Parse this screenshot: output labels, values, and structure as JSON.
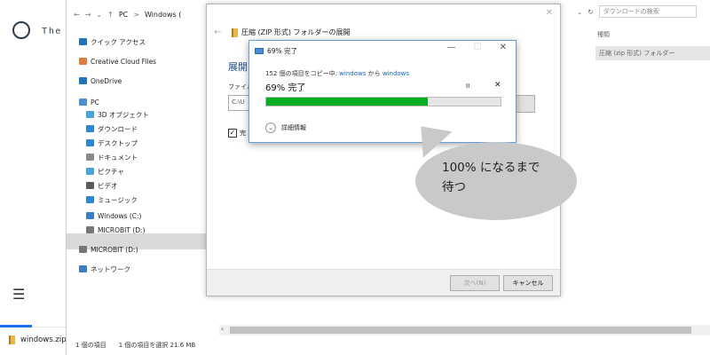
{
  "webpage": {
    "logo_text": "The",
    "menu_icon": "hamburger-icon"
  },
  "download_bar": {
    "filename": "windows.zip"
  },
  "explorer": {
    "address": {
      "root": "PC",
      "sep": ">",
      "current": "Windows ("
    },
    "search_placeholder": "ダウンロードの検索",
    "refresh_icon": "refresh-icon",
    "column_type": "種類",
    "row_type_value": "圧縮 (zip 形式) フォルダー",
    "nav": [
      {
        "label": "クイック アクセス",
        "icon": "star-icon",
        "color": "#1e73be"
      },
      {
        "label": "Creative Cloud Files",
        "icon": "folder-icon",
        "color": "#e07b39"
      },
      {
        "label": "OneDrive",
        "icon": "cloud-icon",
        "color": "#1e73be"
      },
      {
        "label": "PC",
        "icon": "computer-icon",
        "color": "#4a8fd6"
      },
      {
        "label": "3D オブジェクト",
        "icon": "cube-icon",
        "color": "#4aa3df"
      },
      {
        "label": "ダウンロード",
        "icon": "download-icon",
        "color": "#2f86d1"
      },
      {
        "label": "デスクトップ",
        "icon": "desktop-icon",
        "color": "#2f86d1"
      },
      {
        "label": "ドキュメント",
        "icon": "document-icon",
        "color": "#8a8a8a"
      },
      {
        "label": "ピクチャ",
        "icon": "picture-icon",
        "color": "#4aa3df"
      },
      {
        "label": "ビデオ",
        "icon": "video-icon",
        "color": "#5a5a5a"
      },
      {
        "label": "ミュージック",
        "icon": "music-icon",
        "color": "#2f86d1"
      },
      {
        "label": "Windows (C:)",
        "icon": "drive-icon",
        "color": "#3d7cc9"
      },
      {
        "label": "MICROBIT (D:)",
        "icon": "usb-drive-icon",
        "color": "#777777"
      },
      {
        "label": "MICROBIT (D:)",
        "icon": "usb-drive-icon",
        "color": "#777777"
      },
      {
        "label": "ネットワーク",
        "icon": "network-icon",
        "color": "#3d7cc9"
      }
    ],
    "status_items": "1 個の項目",
    "status_selected": "1 個の項目を選択  21.6 MB"
  },
  "extract_dialog": {
    "title": "圧縮 (ZIP 形式) フォルダーの展開",
    "heading": "展開",
    "file_label": "ファイル",
    "path_value": "C:\\U",
    "browse_label": "",
    "checkbox_label": "完",
    "next_label": "次へ(N)",
    "cancel_label": "キャンセル"
  },
  "progress_dialog": {
    "title": "69% 完了",
    "items_prefix": "152 個の項目をコピー中: ",
    "from": "windows",
    "middle": " から ",
    "to": "windows",
    "percent_text": "69% 完了",
    "progress": 0.69,
    "pause_label": "II",
    "stop_label": "✕",
    "details_label": "詳細情報",
    "bar_color": "#06b025"
  },
  "callout": {
    "line1": "100% になるまで",
    "line2": "待つ"
  }
}
